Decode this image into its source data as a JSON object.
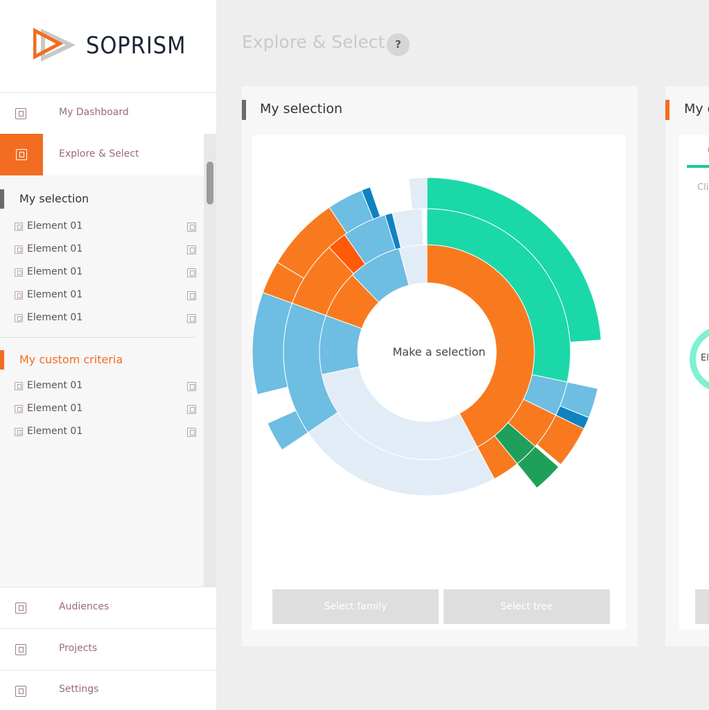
{
  "brand": {
    "name": "SOPRISM",
    "accent": "#f26d21",
    "teal": "#1bd8a8"
  },
  "nav": {
    "dashboard": "My Dashboard",
    "explore": "Explore & Select",
    "audiences": "Audiences",
    "projects": "Projects",
    "settings": "Settings"
  },
  "selection": {
    "title": "My  selection",
    "items": [
      "Element 01",
      "Element 01",
      "Element 01",
      "Element 01",
      "Element 01"
    ]
  },
  "criteria": {
    "title": "My custom criteria",
    "items": [
      "Element 01",
      "Element 01",
      "Element 01"
    ]
  },
  "main": {
    "page_title": "Explore & Select",
    "help": "?",
    "card_title": "My selection",
    "center_label": "Make a selection",
    "btn_family": "Select family",
    "btn_tree": "Select tree",
    "card2_title": "My c",
    "card2_tab": "C",
    "card2_hint": "Cli",
    "card2_ring_label": "El"
  }
}
